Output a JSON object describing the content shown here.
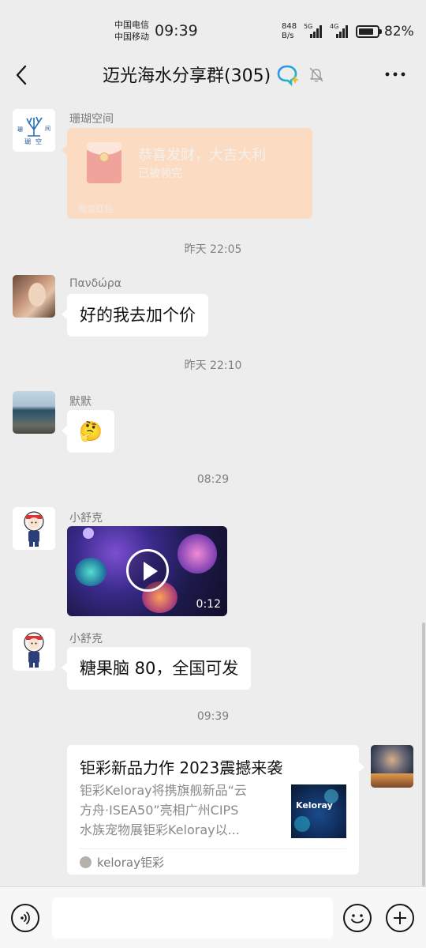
{
  "status_bar": {
    "carrier_1": "中国电信",
    "carrier_2": "中国移动",
    "time": "09:39",
    "net_speed_value": "848",
    "net_speed_unit": "B/s",
    "sim1_type": "5G",
    "sim2_type": "4G",
    "battery_percent": "82%"
  },
  "header": {
    "title": "迈光海水分享群(305)"
  },
  "messages": {
    "m1": {
      "sender": "珊瑚空间",
      "avatar_text_1": "珊",
      "avatar_text_2": "间",
      "avatar_text_3": "瑚",
      "avatar_text_4": "空",
      "red_packet": {
        "title": "恭喜发财，大吉大利",
        "status": "已被领完",
        "footer": "微信红包"
      }
    },
    "ts1": "昨天 22:05",
    "m2": {
      "sender": "Πανδώρα",
      "text": "好的我去加个价"
    },
    "ts2": "昨天 22:10",
    "m3": {
      "sender": "默默",
      "emoji": "🤔"
    },
    "ts3": "08:29",
    "m4": {
      "sender": "小舒克",
      "video_duration": "0:12"
    },
    "m5": {
      "sender": "小舒克",
      "text": "糖果脑 80，全国可发"
    },
    "ts4": "09:39",
    "m6": {
      "card_title": "钜彩新品力作 2023震撼来袭",
      "card_desc_line1": "钜彩Keloray将携旗舰新品“云",
      "card_desc_line2": "方舟·ISEA50”亮相广州CIPS",
      "card_desc_line3": "水族宠物展钜彩Keloray以...",
      "thumb_brand": "Keloray",
      "source": "keloray钜彩"
    }
  },
  "input_bar": {
    "placeholder": ""
  },
  "colors": {
    "background": "#ededed",
    "bubble": "#ffffff",
    "red_packet_opened": "#fbdcc3",
    "timestamp": "#7f7f7f"
  }
}
